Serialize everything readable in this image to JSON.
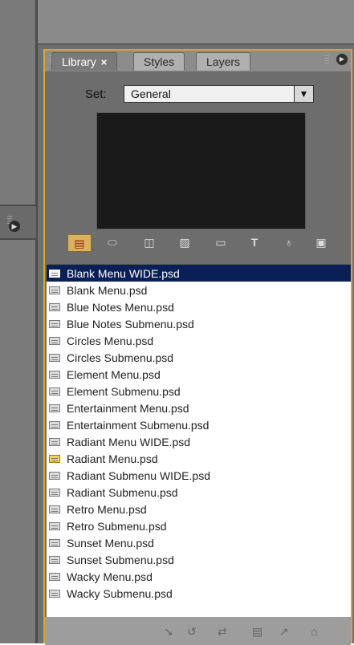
{
  "panel": {
    "tabs": [
      {
        "label": "Library",
        "close": "×"
      },
      {
        "label": "Styles"
      },
      {
        "label": "Layers"
      }
    ],
    "set_label": "Set:",
    "set_value": "General",
    "dropdown_arrow": "▼",
    "menu_icon": "▶"
  },
  "collapsed_panel_icon": "▶",
  "toolbar_icons": [
    {
      "name": "menu-template-icon",
      "glyph": "▤",
      "selected": true
    },
    {
      "name": "button-icon",
      "glyph": "⬭"
    },
    {
      "name": "image-icon",
      "glyph": "◫"
    },
    {
      "name": "texture-icon",
      "glyph": "▨"
    },
    {
      "name": "folder-icon",
      "glyph": "▭"
    },
    {
      "name": "text-icon",
      "glyph": "T"
    },
    {
      "name": "pen-icon",
      "glyph": "♁"
    },
    {
      "name": "media-icon",
      "glyph": "▣"
    }
  ],
  "list": [
    {
      "label": "Blank Menu WIDE.psd",
      "selected": true
    },
    {
      "label": "Blank Menu.psd"
    },
    {
      "label": "Blue Notes Menu.psd"
    },
    {
      "label": "Blue Notes Submenu.psd"
    },
    {
      "label": "Circles Menu.psd"
    },
    {
      "label": "Circles Submenu.psd"
    },
    {
      "label": "Element Menu.psd"
    },
    {
      "label": "Element Submenu.psd"
    },
    {
      "label": "Entertainment Menu.psd"
    },
    {
      "label": "Entertainment Submenu.psd"
    },
    {
      "label": "Radiant Menu WIDE.psd"
    },
    {
      "label": "Radiant Menu.psd",
      "highlighted": true
    },
    {
      "label": "Radiant Submenu WIDE.psd"
    },
    {
      "label": "Radiant Submenu.psd"
    },
    {
      "label": "Retro Menu.psd"
    },
    {
      "label": "Retro Submenu.psd"
    },
    {
      "label": "Sunset Menu.psd"
    },
    {
      "label": "Sunset Submenu.psd"
    },
    {
      "label": "Wacky Menu.psd"
    },
    {
      "label": "Wacky Submenu.psd"
    }
  ],
  "bottom_icons": [
    {
      "name": "place-icon",
      "glyph": "↘"
    },
    {
      "name": "refresh-icon",
      "glyph": "↺"
    },
    {
      "name": "replace-icon",
      "glyph": "⇄"
    },
    {
      "name": "menu-edit-icon",
      "glyph": "▤"
    },
    {
      "name": "new-icon",
      "glyph": "↗"
    },
    {
      "name": "trash-icon",
      "glyph": "⌂"
    }
  ]
}
